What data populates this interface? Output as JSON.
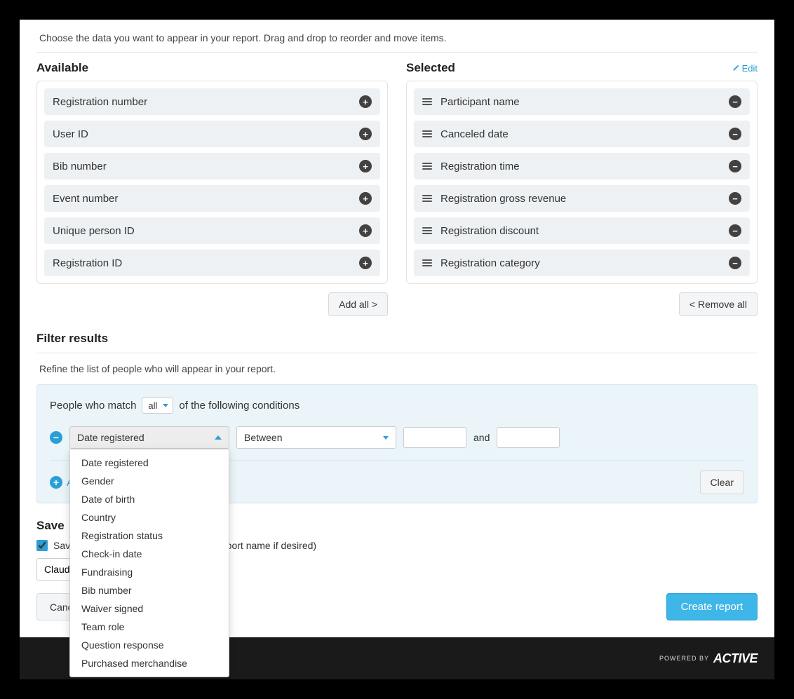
{
  "instruction": "Choose the data you want to appear in your report. Drag and drop to reorder and move items.",
  "available": {
    "title": "Available",
    "items": [
      "Registration number",
      "User ID",
      "Bib number",
      "Event number",
      "Unique person ID",
      "Registration ID"
    ],
    "add_all_label": "Add all >"
  },
  "selected": {
    "title": "Selected",
    "edit_label": "Edit",
    "items": [
      "Participant name",
      "Canceled date",
      "Registration time",
      "Registration gross revenue",
      "Registration discount",
      "Registration category"
    ],
    "remove_all_label": "< Remove all"
  },
  "filter": {
    "section_title": "Filter results",
    "instruction": "Refine the list of people who will appear in your report.",
    "match_prefix": "People who match",
    "match_mode": "all",
    "match_suffix": "of the following conditions",
    "field_selected": "Date registered",
    "operator_selected": "Between",
    "and_label": "and",
    "field_options": [
      "Date registered",
      "Gender",
      "Date of birth",
      "Country",
      "Registration status",
      "Check-in date",
      "Fundraising",
      "Bib number",
      "Waiver signed",
      "Team role",
      "Question response",
      "Purchased merchandise"
    ],
    "add_condition_label": "Add another condition",
    "clear_label": "Clear"
  },
  "save": {
    "section_title": "Save",
    "checkbox_label": "Save this report for future use (adjust report name if desired)",
    "report_name": "Claudia's cancellation report"
  },
  "actions": {
    "cancel_label": "Cancel",
    "create_label": "Create report"
  },
  "footer": {
    "powered_by": "POWERED BY",
    "brand": "ACTIVE"
  }
}
